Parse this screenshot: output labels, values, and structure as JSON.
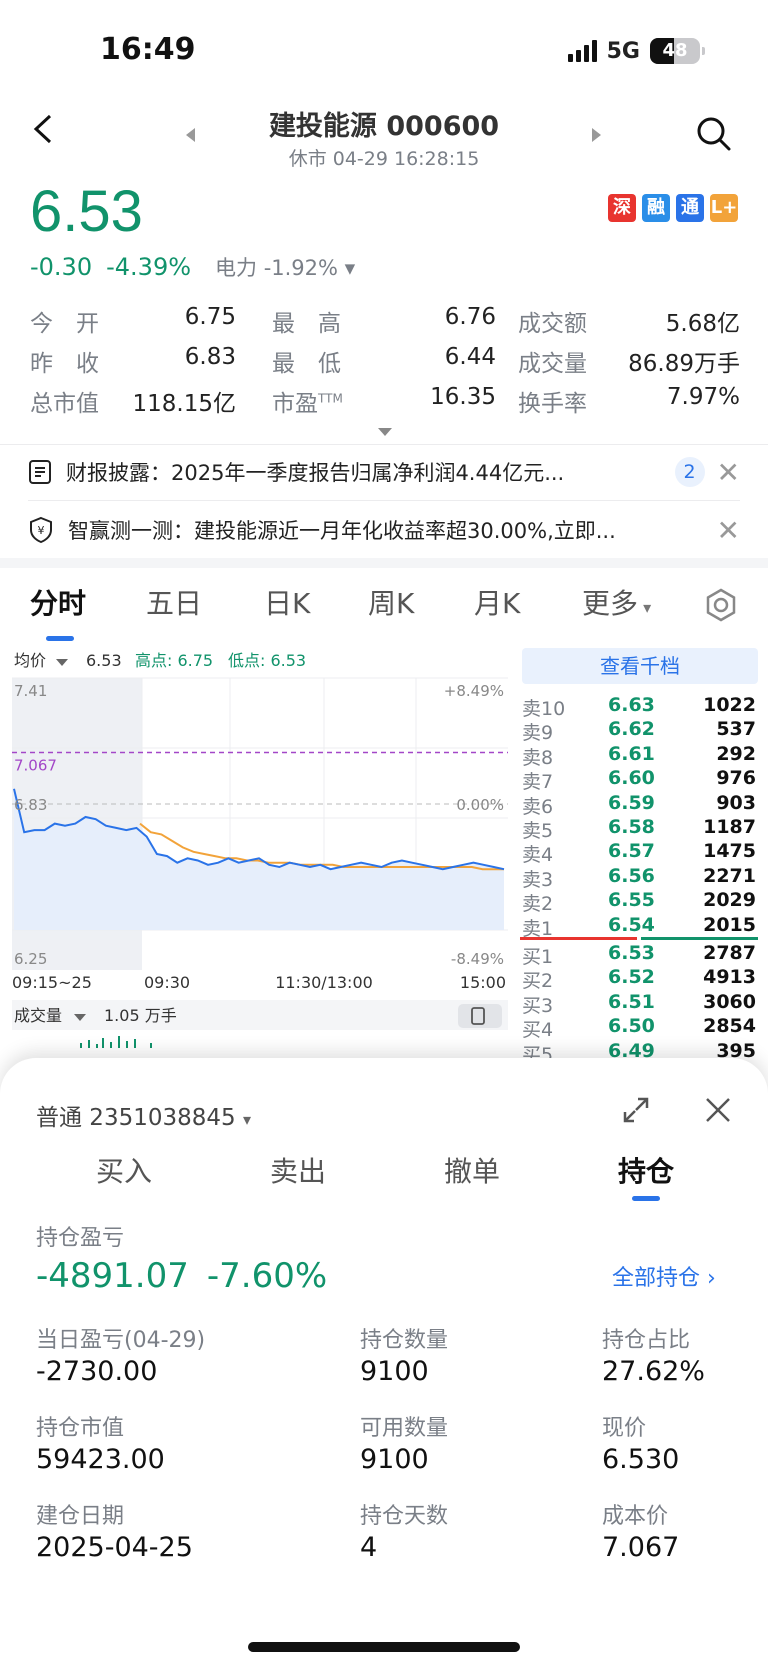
{
  "status": {
    "time": "16:49",
    "network": "5G",
    "battery": "48"
  },
  "header": {
    "title": "建投能源 000600",
    "subtitle": "休市 04-29 16:28:15"
  },
  "quote": {
    "price": "6.53",
    "change": "-0.30",
    "change_pct": "-4.39%",
    "sector": "电力 -1.92%",
    "badges": [
      {
        "text": "深",
        "color": "#e8342f"
      },
      {
        "text": "融",
        "color": "#2a8ee8"
      },
      {
        "text": "通",
        "color": "#2a73e8"
      },
      {
        "text": "L+",
        "color": "#f2a33a"
      }
    ]
  },
  "stats": [
    [
      {
        "label": "今　开",
        "value": "6.75",
        "green": true
      },
      {
        "label": "最　高",
        "value": "6.76",
        "green": true
      },
      {
        "label": "成交额",
        "value": "5.68亿"
      }
    ],
    [
      {
        "label": "昨　收",
        "value": "6.83"
      },
      {
        "label": "最　低",
        "value": "6.44",
        "green": true
      },
      {
        "label": "成交量",
        "value": "86.89万手"
      }
    ],
    [
      {
        "label": "总市值",
        "value": "118.15亿"
      },
      {
        "label": "市盈",
        "value": "16.35",
        "sup": "TTM"
      },
      {
        "label": "换手率",
        "value": "7.97%"
      }
    ]
  ],
  "news": [
    {
      "text": "财报披露：2025年一季度报告归属净利润4.44亿元...",
      "count": "2"
    },
    {
      "text": "智赢测一测：建投能源近一月年化收益率超30.00%,立即..."
    }
  ],
  "tabs": [
    "分时",
    "五日",
    "日K",
    "周K",
    "月K",
    "更多"
  ],
  "chart_data": {
    "type": "line",
    "legend": {
      "avg_label": "均价",
      "avg_value": "6.53",
      "high": "高点: 6.75",
      "low": "低点: 6.53"
    },
    "y_labels": {
      "top": "7.41",
      "mid": "6.83",
      "bottom": "6.25",
      "cost": "7.067"
    },
    "pct_labels": {
      "top": "+8.49%",
      "mid": "0.00%",
      "bottom": "-8.49%"
    },
    "x_labels": [
      "09:15~25",
      "09:30",
      "11:30/13:00",
      "15:00"
    ],
    "ylim": [
      6.25,
      7.41
    ],
    "prev_close": 6.83,
    "cost_line": 7.067,
    "price_series": [
      6.9,
      6.7,
      6.71,
      6.71,
      6.74,
      6.73,
      6.74,
      6.77,
      6.76,
      6.73,
      6.72,
      6.71,
      6.72,
      6.68,
      6.6,
      6.59,
      6.56,
      6.58,
      6.57,
      6.55,
      6.56,
      6.58,
      6.56,
      6.57,
      6.58,
      6.55,
      6.54,
      6.56,
      6.55,
      6.54,
      6.55,
      6.53,
      6.54,
      6.55,
      6.56,
      6.55,
      6.54,
      6.56,
      6.57,
      6.56,
      6.55,
      6.54,
      6.53,
      6.54,
      6.55,
      6.56,
      6.55,
      6.54,
      6.53
    ],
    "avg_series": [
      6.74,
      6.7,
      6.69,
      6.66,
      6.63,
      6.61,
      6.6,
      6.59,
      6.58,
      6.58,
      6.57,
      6.57,
      6.56,
      6.56,
      6.56,
      6.55,
      6.55,
      6.55,
      6.55,
      6.54,
      6.54,
      6.54,
      6.54,
      6.54,
      6.54,
      6.54,
      6.54,
      6.54,
      6.54,
      6.54,
      6.54,
      6.54,
      6.53,
      6.53,
      6.53
    ],
    "volume_label": "成交量",
    "volume_value": "1.05 万手"
  },
  "orderbook": {
    "title": "查看千档",
    "asks": [
      {
        "label": "卖10",
        "price": "6.63",
        "vol": "1022"
      },
      {
        "label": "卖9",
        "price": "6.62",
        "vol": "537"
      },
      {
        "label": "卖8",
        "price": "6.61",
        "vol": "292"
      },
      {
        "label": "卖7",
        "price": "6.60",
        "vol": "976"
      },
      {
        "label": "卖6",
        "price": "6.59",
        "vol": "903"
      },
      {
        "label": "卖5",
        "price": "6.58",
        "vol": "1187"
      },
      {
        "label": "卖4",
        "price": "6.57",
        "vol": "1475"
      },
      {
        "label": "卖3",
        "price": "6.56",
        "vol": "2271"
      },
      {
        "label": "卖2",
        "price": "6.55",
        "vol": "2029"
      },
      {
        "label": "卖1",
        "price": "6.54",
        "vol": "2015"
      }
    ],
    "bids": [
      {
        "label": "买1",
        "price": "6.53",
        "vol": "2787"
      },
      {
        "label": "买2",
        "price": "6.52",
        "vol": "4913"
      },
      {
        "label": "买3",
        "price": "6.51",
        "vol": "3060"
      },
      {
        "label": "买4",
        "price": "6.50",
        "vol": "2854"
      },
      {
        "label": "买5",
        "price": "6.49",
        "vol": "395"
      }
    ]
  },
  "sheet": {
    "account": "普通 2351038845",
    "tabs": [
      "买入",
      "卖出",
      "撤单",
      "持仓"
    ],
    "pnl_label": "持仓盈亏",
    "pnl_value": "-4891.07",
    "pnl_pct": "-7.60%",
    "all_positions": "全部持仓",
    "fields": [
      {
        "label": "当日盈亏(04-29)",
        "value": "-2730.00",
        "green": true
      },
      {
        "label": "持仓数量",
        "value": "9100"
      },
      {
        "label": "持仓占比",
        "value": "27.62%"
      },
      {
        "label": "持仓市值",
        "value": "59423.00"
      },
      {
        "label": "可用数量",
        "value": "9100"
      },
      {
        "label": "现价",
        "value": "6.530"
      },
      {
        "label": "建仓日期",
        "value": "2025-04-25"
      },
      {
        "label": "持仓天数",
        "value": "4"
      },
      {
        "label": "成本价",
        "value": "7.067"
      }
    ]
  }
}
